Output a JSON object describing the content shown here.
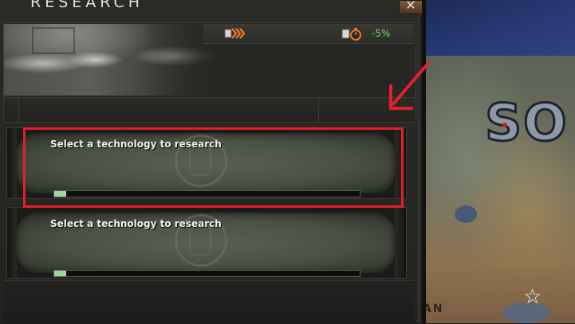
{
  "panel": {
    "title": "RESEARCH",
    "close_icon_glyph": "✕",
    "research_speed": "-5%",
    "icons": {
      "boost": "research-boost-icon",
      "speed": "research-speed-icon",
      "close": "close-icon"
    }
  },
  "slots": [
    {
      "label": "Select a technology to research",
      "progress": 0.04
    },
    {
      "label": "Select a technology to research",
      "progress": 0.04
    }
  ],
  "map": {
    "country_label": "SO",
    "partial_label": "AN",
    "star_glyph": "☆",
    "sea_color": "#273a75",
    "city_color": "#d02020"
  },
  "annotation": {
    "color": "#e3202a"
  }
}
